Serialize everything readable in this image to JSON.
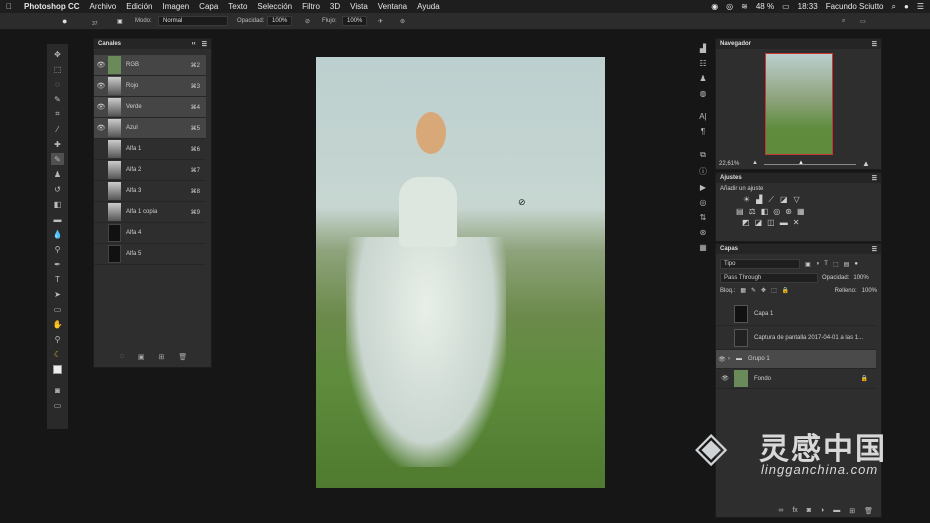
{
  "menubar": {
    "app": "Photoshop CC",
    "items": [
      "Archivo",
      "Edición",
      "Imagen",
      "Capa",
      "Texto",
      "Selección",
      "Filtro",
      "3D",
      "Vista",
      "Ventana",
      "Ayuda"
    ],
    "battery": "48 %",
    "time": "18:33",
    "user": "Facundo Sciutto"
  },
  "options": {
    "brush_size": "37",
    "mode_label": "Modo:",
    "mode_value": "Normal",
    "opacity_label": "Opacidad:",
    "opacity_value": "100%",
    "flow_label": "Flujo:",
    "flow_value": "100%"
  },
  "channels": {
    "title": "Canales",
    "items": [
      {
        "name": "RGB",
        "shortcut": "⌘2"
      },
      {
        "name": "Rojo",
        "shortcut": "⌘3"
      },
      {
        "name": "Verde",
        "shortcut": "⌘4"
      },
      {
        "name": "Azul",
        "shortcut": "⌘5"
      },
      {
        "name": "Alfa 1",
        "shortcut": "⌘6"
      },
      {
        "name": "Alfa 2",
        "shortcut": "⌘7"
      },
      {
        "name": "Alfa 3",
        "shortcut": "⌘8"
      },
      {
        "name": "Alfa 1 copia",
        "shortcut": "⌘9"
      },
      {
        "name": "Alfa 4",
        "shortcut": ""
      },
      {
        "name": "Alfa 5",
        "shortcut": ""
      }
    ]
  },
  "navigator": {
    "title": "Navegador",
    "zoom": "22,61%"
  },
  "adjustments": {
    "title": "Ajustes",
    "subtitle": "Añadir un ajuste"
  },
  "layers": {
    "title": "Capas",
    "filter": "Tipo",
    "blend": "Pass Through",
    "opacity_label": "Opacidad:",
    "opacity_value": "100%",
    "lock_label": "Bloq.:",
    "fill_label": "Relleno:",
    "fill_value": "100%",
    "items": [
      {
        "name": "Capa 1"
      },
      {
        "name": "Captura de pantalla 2017-04-01 a las 1..."
      },
      {
        "name": "Grupo 1"
      },
      {
        "name": "Fondo"
      }
    ]
  },
  "watermark": {
    "brand": "灵感中国",
    "url": "lingganchina.com"
  },
  "colors": {
    "accent": "#4a90d9",
    "panel": "#2e2e2e",
    "bg": "#161616"
  }
}
